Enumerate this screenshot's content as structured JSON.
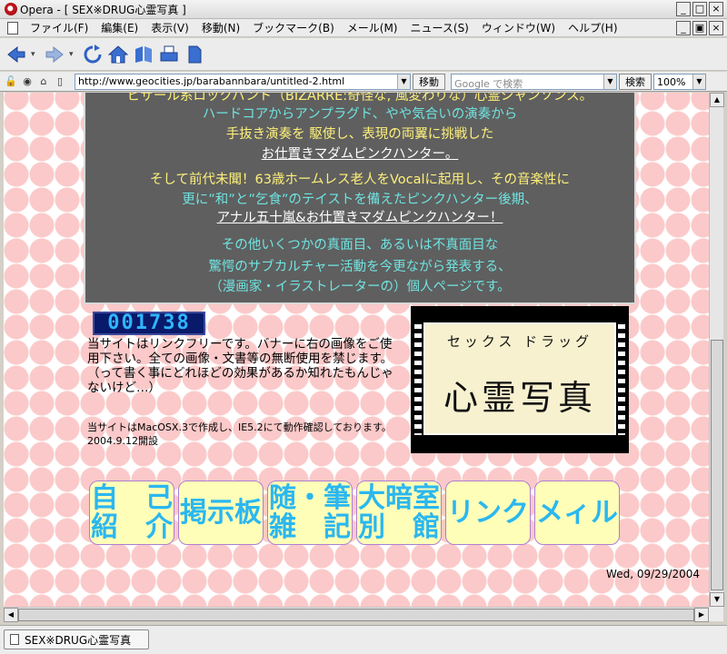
{
  "window": {
    "title": "Opera - [ SEX※DRUG心霊写真 ]",
    "min_label": "_",
    "max_label": "□",
    "close_label": "×",
    "restore_label": "▣"
  },
  "menu": [
    "ファイル(F)",
    "編集(E)",
    "表示(V)",
    "移動(N)",
    "ブックマーク(B)",
    "メール(M)",
    "ニュース(S)",
    "ウィンドウ(W)",
    "ヘルプ(H)"
  ],
  "address": {
    "url": "http://www.geocities.jp/barabannbara/untitled-2.html",
    "go_label": "移動",
    "search_placeholder": "Google で検索",
    "search_button": "検索",
    "zoom": "100%"
  },
  "intro_lines": [
    "ビザール系ロックバンド（BIZARRE:奇怪な, 風変わりな）心霊シャンソンス。",
    "ハードコアからアンプラグド、やや気合いの演奏から",
    "手抜き演奏を 駆使し、表現の両翼に挑戦した",
    "お仕置きマダムピンクハンター。",
    "そして前代未聞！63歳ホームレス老人をVocalに起用し、その音楽性に",
    "更に”和”と”乞食”のテイストを備えたピンクハンター後期、",
    "アナル五十嵐&お仕置きマダムピンクハンター！",
    "その他いくつかの真面目、あるいは不真面目な",
    "驚愕のサブカルチャー活動を今更ながら発表する、",
    "（漫画家・イラストレーターの）個人ページです。"
  ],
  "counter": "001738",
  "info_text": "当サイトはリンクフリーです。バナーに右の画像をご使用下さい。全ての画像・文書等の無断使用を禁じます。（って書く事にどれほどの効果があるか知れたもんじゃないけど…）",
  "info_small": "当サイトはMacOSX.3で作成し、IE5.2にて動作確認しております。2004.9.12開設",
  "banner": {
    "sub": "セックス ドラッグ",
    "main": "心霊写真"
  },
  "nav": [
    {
      "label": "自　己\n紹　介"
    },
    {
      "label": "掲示板"
    },
    {
      "label": "随・筆\n雑　記"
    },
    {
      "label": "大暗室\n別　館"
    },
    {
      "label": "リンク"
    },
    {
      "label": "メィル"
    }
  ],
  "date": "Wed, 09/29/2004",
  "tab": {
    "label": "SEX※DRUG心霊写真"
  },
  "colors": {
    "text_yellow": "#fef07a",
    "text_cyan": "#6fe3e0",
    "panel_gray": "#5f5f5f",
    "dot_pink": "#fbc9c9",
    "nav_bg": "#fefeb8",
    "nav_text": "#2bb7ef"
  }
}
